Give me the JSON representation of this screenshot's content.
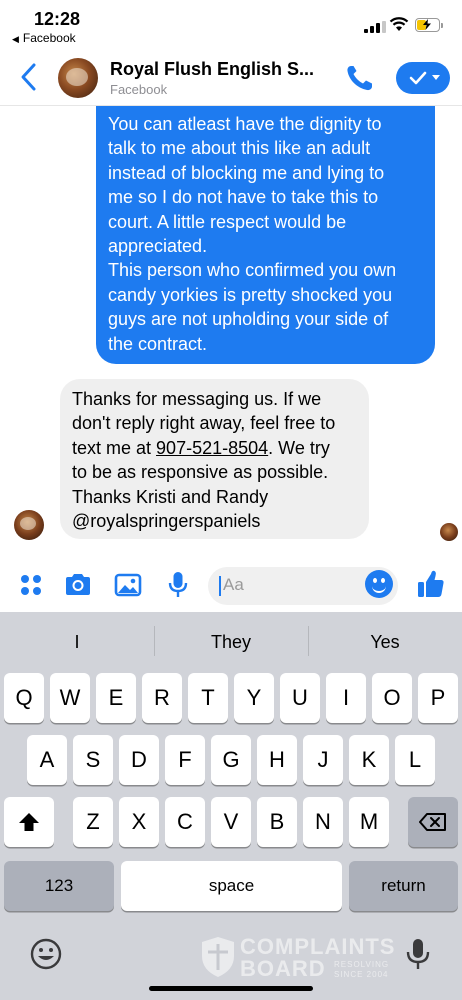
{
  "status_bar": {
    "time": "12:28",
    "back_app": "Facebook"
  },
  "header": {
    "title": "Royal Flush English S...",
    "subtitle": "Facebook",
    "call_icon": "phone-icon",
    "verify_icon": "check-icon"
  },
  "messages": {
    "outgoing": [
      "You can atleast have the dignity to",
      "talk to me about this like an adult",
      "instead of blocking me and lying to",
      "me so I do not have to take this to",
      "court. A little respect would be",
      "appreciated.",
      "This person who confirmed you own",
      "candy yorkies is pretty shocked you",
      "guys are not upholding your side of",
      "the contract."
    ],
    "incoming": {
      "line1": "Thanks for messaging us. If we",
      "line2": "don't reply right away, feel free to",
      "line3_pre": "text me at ",
      "phone": "907-521-8504",
      "line3_post": ". We try",
      "line4": "to be as responsive as possible.",
      "line5": "Thanks Kristi and Randy",
      "line6": "@royalspringerspaniels"
    }
  },
  "composer": {
    "placeholder": "Aa",
    "icons": [
      "apps-icon",
      "camera-icon",
      "gallery-icon",
      "microphone-icon",
      "emoji-icon",
      "thumbs-up-icon"
    ]
  },
  "keyboard": {
    "suggestions": [
      "I",
      "They",
      "Yes"
    ],
    "row1": [
      "Q",
      "W",
      "E",
      "R",
      "T",
      "Y",
      "U",
      "I",
      "O",
      "P"
    ],
    "row2": [
      "A",
      "S",
      "D",
      "F",
      "G",
      "H",
      "J",
      "K",
      "L"
    ],
    "row3": [
      "Z",
      "X",
      "C",
      "V",
      "B",
      "N",
      "M"
    ],
    "numbers_key": "123",
    "space_key": "space",
    "return_key": "return"
  },
  "watermark": {
    "line1": "COMPLAINTS",
    "line2": "BOARD",
    "tag1": "RESOLVING",
    "tag2": "SINCE 2004"
  },
  "colors": {
    "accent": "#1e7bf0",
    "incoming_bubble": "#efefef",
    "keyboard_bg": "#d1d3d9",
    "dark_key": "#acb0ba"
  }
}
